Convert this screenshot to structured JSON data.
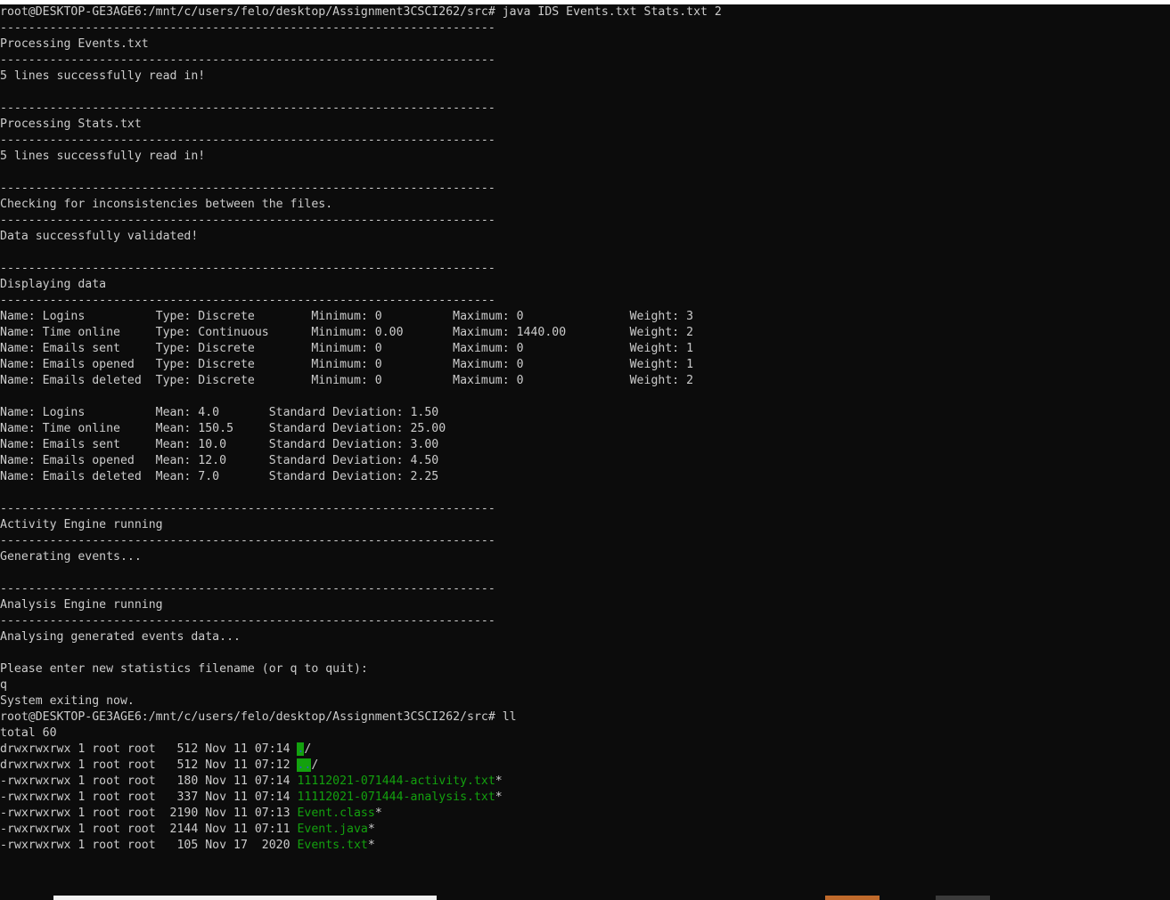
{
  "terminal": {
    "lines": [
      "root@DESKTOP-GE3AGE6:/mnt/c/users/felo/desktop/Assignment3CSCI262/src# java IDS Events.txt Stats.txt 2",
      "----------------------------------------------------------------------",
      "Processing Events.txt",
      "----------------------------------------------------------------------",
      "5 lines successfully read in!",
      "",
      "----------------------------------------------------------------------",
      "Processing Stats.txt",
      "----------------------------------------------------------------------",
      "5 lines successfully read in!",
      "",
      "----------------------------------------------------------------------",
      "Checking for inconsistencies between the files.",
      "----------------------------------------------------------------------",
      "Data successfully validated!",
      "",
      "----------------------------------------------------------------------",
      "Displaying data",
      "----------------------------------------------------------------------",
      "Name: Logins          Type: Discrete        Minimum: 0          Maximum: 0               Weight: 3",
      "Name: Time online     Type: Continuous      Minimum: 0.00       Maximum: 1440.00         Weight: 2",
      "Name: Emails sent     Type: Discrete        Minimum: 0          Maximum: 0               Weight: 1",
      "Name: Emails opened   Type: Discrete        Minimum: 0          Maximum: 0               Weight: 1",
      "Name: Emails deleted  Type: Discrete        Minimum: 0          Maximum: 0               Weight: 2",
      "",
      "Name: Logins          Mean: 4.0       Standard Deviation: 1.50",
      "Name: Time online     Mean: 150.5     Standard Deviation: 25.00",
      "Name: Emails sent     Mean: 10.0      Standard Deviation: 3.00",
      "Name: Emails opened   Mean: 12.0      Standard Deviation: 4.50",
      "Name: Emails deleted  Mean: 7.0       Standard Deviation: 2.25",
      "",
      "----------------------------------------------------------------------",
      "Activity Engine running",
      "----------------------------------------------------------------------",
      "Generating events...",
      "",
      "----------------------------------------------------------------------",
      "Analysis Engine running",
      "----------------------------------------------------------------------",
      "Analysing generated events data...",
      "",
      "Please enter new statistics filename (or q to quit):",
      "q",
      "System exiting now.",
      "root@DESKTOP-GE3AGE6:/mnt/c/users/felo/desktop/Assignment3CSCI262/src# ll",
      "total 60"
    ],
    "listing": [
      {
        "prefix": "drwxrwxrwx 1 root root   512 Nov 11 07:14 ",
        "name": ".",
        "suffix": "/",
        "style": "dir"
      },
      {
        "prefix": "drwxrwxrwx 1 root root   512 Nov 11 07:12 ",
        "name": "..",
        "suffix": "/",
        "style": "dir"
      },
      {
        "prefix": "-rwxrwxrwx 1 root root   180 Nov 11 07:14 ",
        "name": "11112021-071444-activity.txt",
        "suffix": "*",
        "style": "exec"
      },
      {
        "prefix": "-rwxrwxrwx 1 root root   337 Nov 11 07:14 ",
        "name": "11112021-071444-analysis.txt",
        "suffix": "*",
        "style": "exec"
      },
      {
        "prefix": "-rwxrwxrwx 1 root root  2190 Nov 11 07:13 ",
        "name": "Event.class",
        "suffix": "*",
        "style": "exec"
      },
      {
        "prefix": "-rwxrwxrwx 1 root root  2144 Nov 11 07:11 ",
        "name": "Event.java",
        "suffix": "*",
        "style": "exec"
      },
      {
        "prefix": "-rwxrwxrwx 1 root root   105 Nov 17  2020 ",
        "name": "Events.txt",
        "suffix": "*",
        "style": "exec"
      }
    ]
  },
  "colors": {
    "background": "#0c0c0c",
    "text": "#cccccc",
    "executable": "#13a10e",
    "directory_highlight": "#13a10e"
  }
}
